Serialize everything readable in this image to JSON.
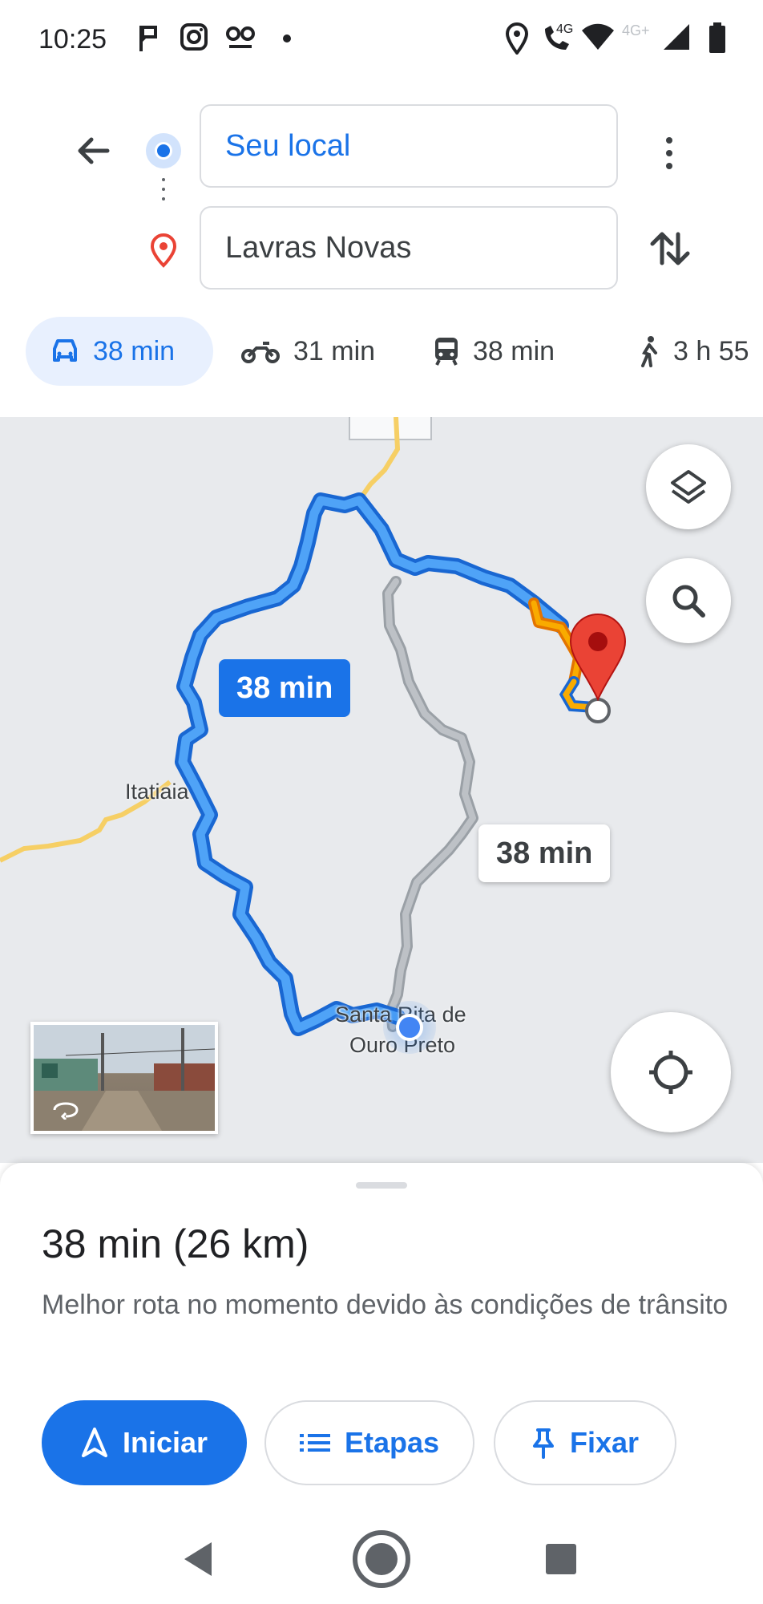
{
  "status_bar": {
    "time": "10:25",
    "icons": [
      "flag-icon",
      "instagram-icon",
      "voicemail-icon",
      "dot-icon",
      "location-icon",
      "call-4g-icon",
      "wifi-icon",
      "signal-icon",
      "battery-icon"
    ],
    "network_label_1": "4G",
    "network_label_2": "4G+"
  },
  "search": {
    "origin": "Seu local",
    "destination": "Lavras Novas"
  },
  "modes": [
    {
      "label": "38 min",
      "icon": "car-icon",
      "selected": true
    },
    {
      "label": "31 min",
      "icon": "motorcycle-icon",
      "selected": false
    },
    {
      "label": "38 min",
      "icon": "transit-icon",
      "selected": false
    },
    {
      "label": "3 h 55",
      "icon": "walk-icon",
      "selected": false
    }
  ],
  "map": {
    "primary_route_time": "38 min",
    "alt_route_time": "38 min",
    "labels": {
      "itatiaia": "Itatiaia",
      "santa_rita_line1": "Santa Rita de",
      "santa_rita_line2": "Ouro Preto"
    },
    "colors": {
      "primary_route": "#1a73e8",
      "alt_route": "#a8abb0",
      "traffic_slow": "#f29900",
      "destination_pin": "#ea4335",
      "highway": "#f6cf65"
    }
  },
  "sheet": {
    "summary": "38 min (26 km)",
    "reason": "Melhor rota no momento devido às condições de trânsito",
    "start_label": "Iniciar",
    "steps_label": "Etapas",
    "pin_label": "Fixar"
  }
}
